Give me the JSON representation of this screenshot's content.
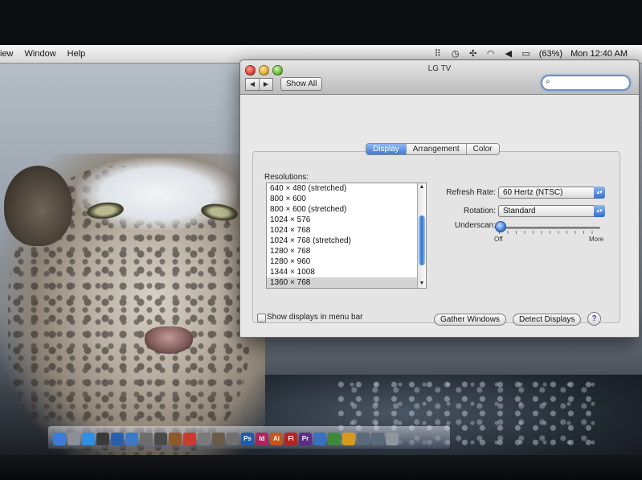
{
  "menubar": {
    "items": [
      "iew",
      "Window",
      "Help"
    ],
    "battery": "(63%)",
    "clock": "Mon 12:40 AM"
  },
  "window": {
    "title": "LG TV",
    "back_label": "◀",
    "forward_label": "▶",
    "show_all": "Show All",
    "search_placeholder": "",
    "tabs": [
      {
        "label": "Display",
        "active": true
      },
      {
        "label": "Arrangement",
        "active": false
      },
      {
        "label": "Color",
        "active": false
      }
    ],
    "resolutions_label": "Resolutions:",
    "resolutions": [
      "640 × 480 (stretched)",
      "800 × 600",
      "800 × 600 (stretched)",
      "1024 × 576",
      "1024 × 768",
      "1024 × 768 (stretched)",
      "1280 × 768",
      "1280 × 960",
      "1344 × 1008",
      "1360 × 768"
    ],
    "selected_resolution": "1360 × 768",
    "refresh_rate_label": "Refresh Rate:",
    "refresh_rate_value": "60 Hertz (NTSC)",
    "rotation_label": "Rotation:",
    "rotation_value": "Standard",
    "underscan_label": "Underscan:",
    "underscan_min": "Off",
    "underscan_max": "More",
    "underscan_level": 0,
    "show_in_menu_bar_label": "Show displays in menu bar",
    "show_in_menu_bar_checked": false,
    "gather_windows": "Gather Windows",
    "detect_displays": "Detect Displays",
    "help": "?"
  },
  "dock": {
    "icons": [
      {
        "name": "finder-icon",
        "color": "#3d7bd8",
        "glyph": ""
      },
      {
        "name": "mail-icon",
        "color": "#8a8f98",
        "glyph": ""
      },
      {
        "name": "safari-icon",
        "color": "#2f8fe0",
        "glyph": ""
      },
      {
        "name": "clock-icon",
        "color": "#3a3a3a",
        "glyph": ""
      },
      {
        "name": "itunes-icon",
        "color": "#2b5ea8",
        "glyph": ""
      },
      {
        "name": "app-store-icon",
        "color": "#3e78c8",
        "glyph": ""
      },
      {
        "name": "contacts-icon",
        "color": "#6d6d6d",
        "glyph": ""
      },
      {
        "name": "photo-icon",
        "color": "#4a4a4a",
        "glyph": ""
      },
      {
        "name": "book-icon",
        "color": "#8e5a2a",
        "glyph": ""
      },
      {
        "name": "calendar-icon",
        "color": "#c93b2e",
        "glyph": ""
      },
      {
        "name": "preview-icon",
        "color": "#7a7a7a",
        "glyph": ""
      },
      {
        "name": "iphoto-icon",
        "color": "#6b5a45",
        "glyph": ""
      },
      {
        "name": "system-prefs-icon",
        "color": "#6f6f6f",
        "glyph": ""
      },
      {
        "name": "photoshop-icon",
        "color": "#1f5ca8",
        "glyph": "Ps"
      },
      {
        "name": "indesign-icon",
        "color": "#b0245c",
        "glyph": "Id"
      },
      {
        "name": "illustrator-icon",
        "color": "#c5561b",
        "glyph": "Ai"
      },
      {
        "name": "flash-icon",
        "color": "#b8231f",
        "glyph": "Fl"
      },
      {
        "name": "premiere-icon",
        "color": "#5b2a8a",
        "glyph": "Pr"
      },
      {
        "name": "app-icon-1",
        "color": "#3a70c0",
        "glyph": ""
      },
      {
        "name": "app-icon-2",
        "color": "#3f8a3a",
        "glyph": ""
      },
      {
        "name": "app-icon-3",
        "color": "#d89a1c",
        "glyph": ""
      },
      {
        "name": "app-icon-4",
        "color": "#5a6a7a",
        "glyph": ""
      },
      {
        "name": "app-icon-5",
        "color": "#5a6a7a",
        "glyph": ""
      },
      {
        "name": "trash-icon",
        "color": "#8e959e",
        "glyph": ""
      }
    ]
  },
  "colors": {
    "accent": "#3d7bd8",
    "window_bg": "#e8e8e8"
  }
}
